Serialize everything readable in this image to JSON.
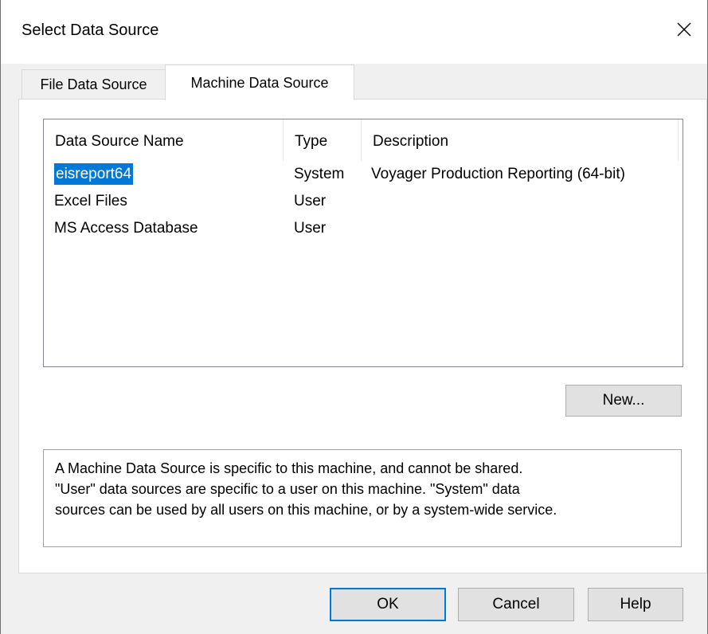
{
  "window": {
    "title": "Select Data Source"
  },
  "icons": {
    "close": "close-icon"
  },
  "tabs": [
    {
      "label": "File Data Source",
      "active": false
    },
    {
      "label": "Machine Data Source",
      "active": true
    }
  ],
  "list": {
    "columns": [
      "Data Source Name",
      "Type",
      "Description"
    ],
    "rows": [
      {
        "name": "eisreport64",
        "type": "System",
        "description": "Voyager Production Reporting (64-bit)",
        "selected": true
      },
      {
        "name": "Excel Files",
        "type": "User",
        "description": "",
        "selected": false
      },
      {
        "name": "MS Access Database",
        "type": "User",
        "description": "",
        "selected": false
      }
    ]
  },
  "buttons": {
    "new": "New...",
    "ok": "OK",
    "cancel": "Cancel",
    "help": "Help"
  },
  "info": {
    "lines": [
      "A Machine Data Source is specific to this machine, and cannot be shared.",
      "\"User\" data sources are specific to a user on this machine.  \"System\" data",
      "sources can be used by all users on this machine, or by a system-wide service."
    ]
  },
  "colors": {
    "selection": "#0078d7",
    "default_button_border": "#0078d7",
    "dialog_background": "#f0f0f0"
  }
}
